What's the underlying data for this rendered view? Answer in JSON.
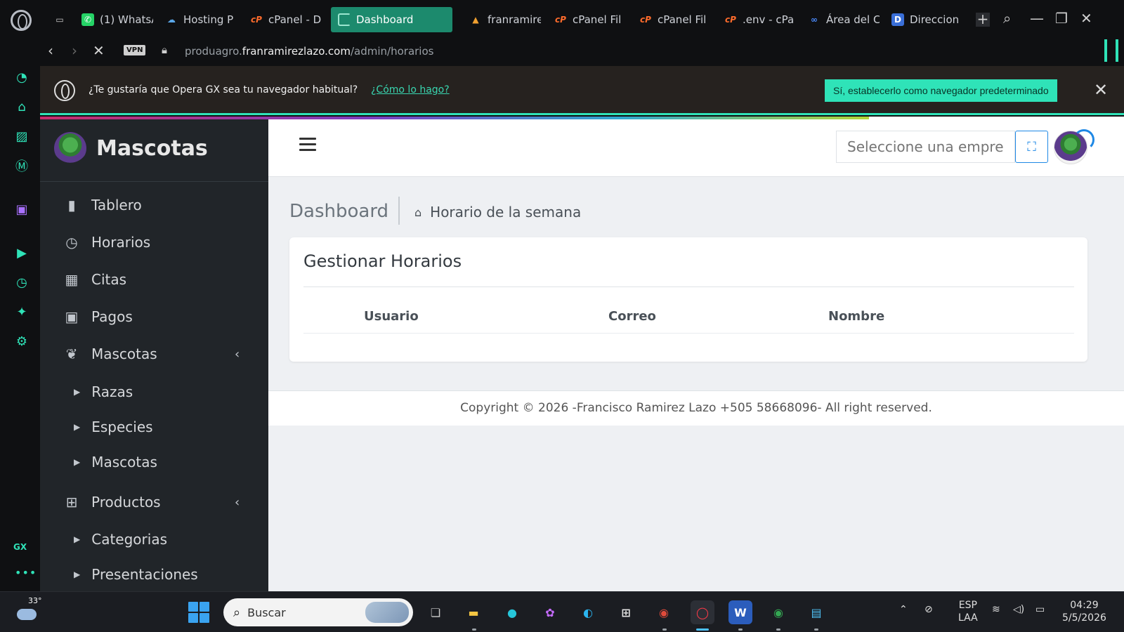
{
  "browser": {
    "tabs": [
      {
        "label": "(1) WhatsA",
        "icon": "whatsapp-icon"
      },
      {
        "label": "Hosting P",
        "icon": "hosting-icon"
      },
      {
        "label": "cPanel - D",
        "icon": "cpanel-icon"
      },
      {
        "label": "Dashboard",
        "icon": "loading-icon",
        "active": true
      },
      {
        "label": "franramire",
        "icon": "franramirez-icon"
      },
      {
        "label": "cPanel Fil",
        "icon": "cpanel-icon"
      },
      {
        "label": "cPanel Fil",
        "icon": "cpanel-icon"
      },
      {
        "label": ".env - cPa",
        "icon": "cpanel-icon"
      },
      {
        "label": "Área del C",
        "icon": "meta-icon"
      },
      {
        "label": "Direccion",
        "icon": "direccion-icon"
      }
    ],
    "vpn_label": "VPN",
    "url_prefix": "produagro.",
    "url_domain": "franramirezlazo.com",
    "url_path": "/admin/horarios"
  },
  "notification": {
    "question": "¿Te gustaría que Opera GX sea tu navegador habitual?",
    "how_link": "¿Cómo lo hago?",
    "yes_button": "Sí, establecerlo como navegador predeterminado"
  },
  "sidebar": {
    "brand": "Mascotas",
    "items": [
      {
        "label": "Tablero",
        "icon": "bar-chart-icon"
      },
      {
        "label": "Horarios",
        "icon": "clock-icon"
      },
      {
        "label": "Citas",
        "icon": "calendar-icon"
      },
      {
        "label": "Pagos",
        "icon": "money-icon"
      },
      {
        "label": "Mascotas",
        "icon": "paw-icon",
        "expandable": true
      },
      {
        "label": "Razas",
        "sub": true
      },
      {
        "label": "Especies",
        "sub": true
      },
      {
        "label": "Mascotas",
        "sub": true
      },
      {
        "label": "Productos",
        "icon": "medkit-icon",
        "expandable": true
      },
      {
        "label": "Categorias",
        "sub": true
      },
      {
        "label": "Presentaciones",
        "sub": true
      }
    ]
  },
  "topbar": {
    "company_placeholder": "Seleccione una empresa"
  },
  "content": {
    "title": "Dashboard",
    "breadcrumb": "Horario de la semana",
    "card_title": "Gestionar Horarios",
    "columns": [
      "Usuario",
      "Correo",
      "Nombre"
    ]
  },
  "footer": {
    "text": "Copyright © 2026 -Francisco Ramirez Lazo +505 58668096- All right reserved."
  },
  "taskbar": {
    "temperature": "33°",
    "search_label": "Buscar",
    "lang_top": "ESP",
    "lang_bottom": "LAA",
    "time": "04:29",
    "date": "5/5/2026"
  }
}
